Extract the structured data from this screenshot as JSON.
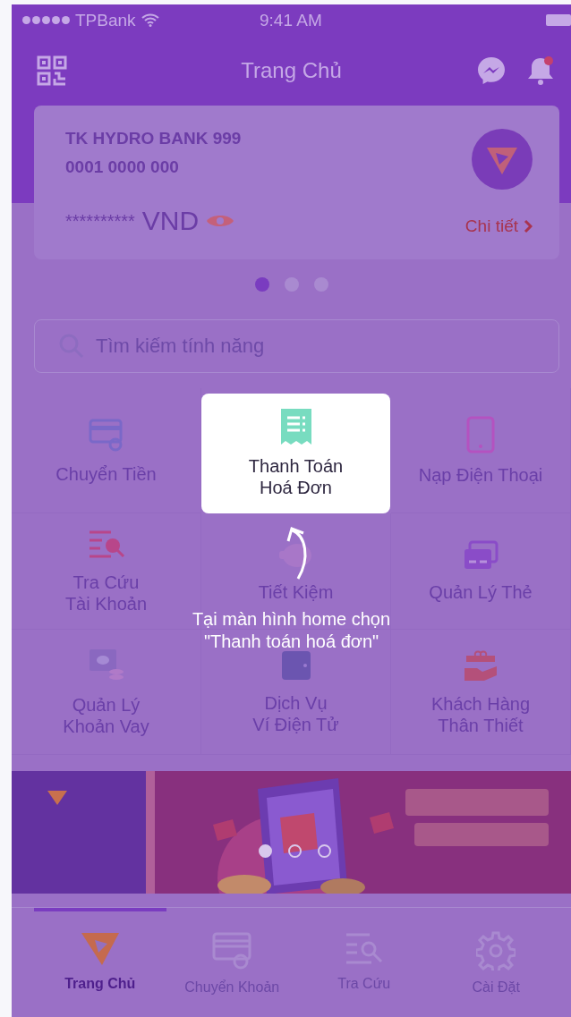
{
  "status_bar": {
    "carrier": "TPBank",
    "time": "9:41 AM"
  },
  "header": {
    "title": "Trang Chủ",
    "notification": true
  },
  "account_card": {
    "name": "TK HYDRO BANK 999",
    "number": "0001 0000 000",
    "balance": "**********",
    "currency": "VND",
    "detail_link": "Chi tiết"
  },
  "card_pager": [
    {
      "selected": true
    },
    {
      "selected": false
    },
    {
      "selected": false
    }
  ],
  "search": {
    "placeholder": "Tìm kiếm tính năng"
  },
  "features": [
    {
      "label": "Chuyển Tiền",
      "highlighted": false
    },
    {
      "label": "Thanh Toán\nHoá Đơn",
      "highlighted": true
    },
    {
      "label": "Nạp Điện Thoại",
      "highlighted": false
    },
    {
      "label": "Tra Cứu\nTài Khoản",
      "highlighted": false
    },
    {
      "label": "Tiết Kiệm",
      "highlighted": false
    },
    {
      "label": "Quản Lý Thẻ",
      "highlighted": false
    },
    {
      "label": "Quản Lý\nKhoản Vay",
      "highlighted": false
    },
    {
      "label": "Dịch Vụ\nVí Điện Tử",
      "highlighted": false
    },
    {
      "label": "Khách Hàng\nThân Thiết",
      "highlighted": false
    }
  ],
  "tooltip": {
    "text": "Tại màn hình home chọn\n\"Thanh toán hoá đơn\""
  },
  "banner": {
    "kind": "picture",
    "pager": [
      {
        "selected": true
      },
      {
        "selected": false
      },
      {
        "selected": false
      }
    ]
  },
  "tab_bar": [
    {
      "label": "Trang Chủ",
      "selected": true
    },
    {
      "label": "Chuyển Khoản",
      "selected": false
    },
    {
      "label": "Tra Cứu",
      "selected": false
    },
    {
      "label": "Cài Đặt",
      "selected": false
    }
  ]
}
